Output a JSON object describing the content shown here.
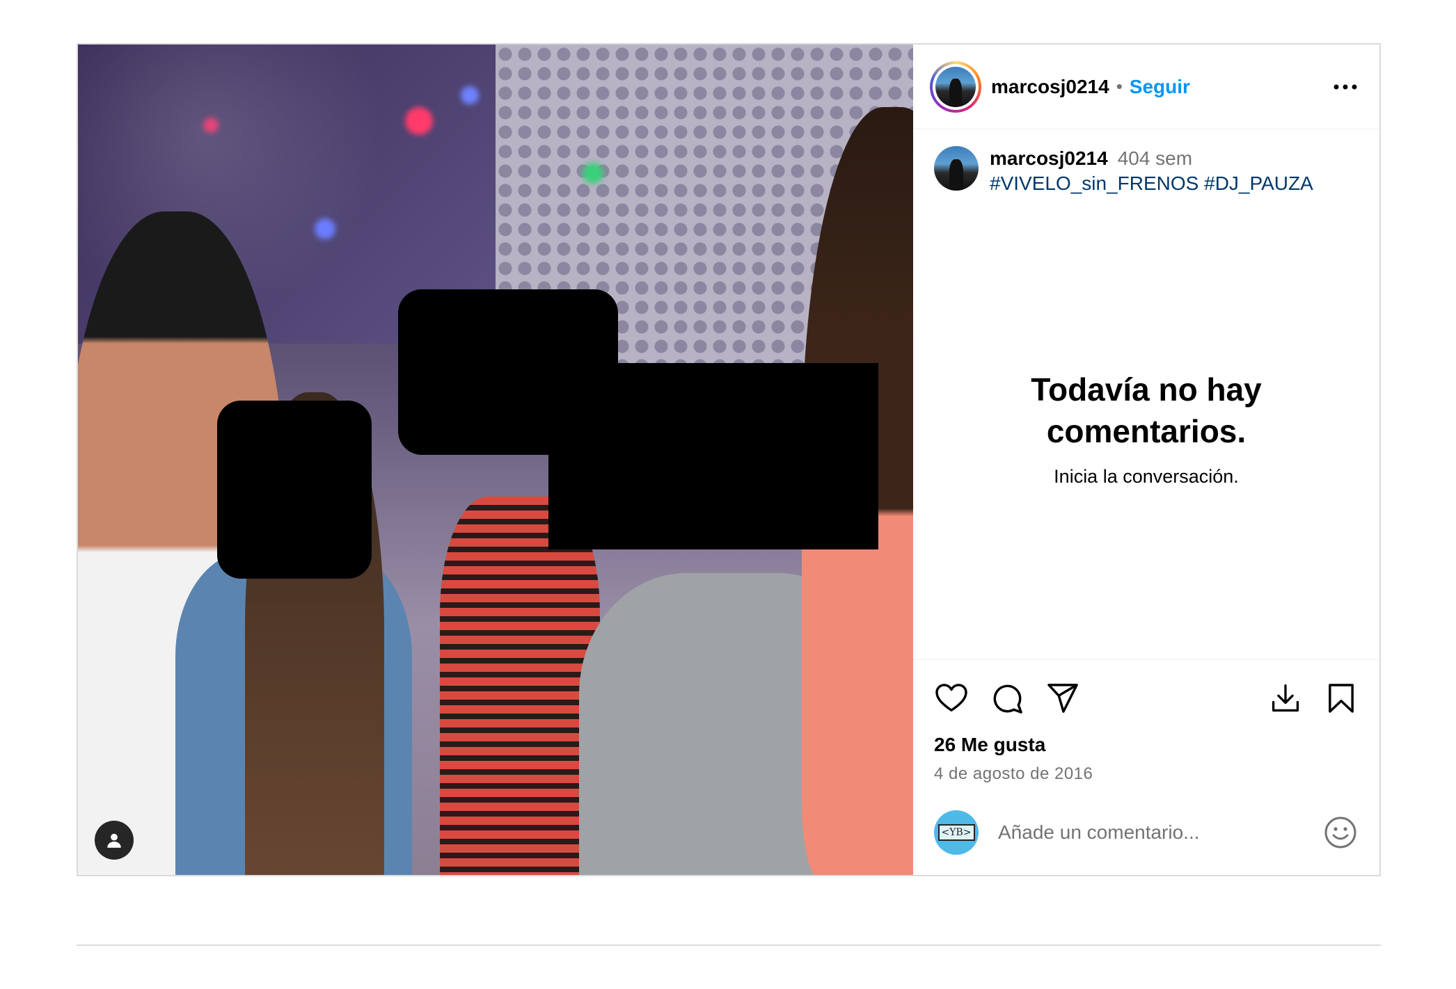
{
  "post": {
    "header": {
      "username": "marcosj0214",
      "separator": "•",
      "follow_label": "Seguir",
      "more_icon": "more-horizontal-icon"
    },
    "caption": {
      "username": "marcosj0214",
      "time": "404 sem",
      "text": "#VIVELO_sin_FRENOS #DJ_PAUZA"
    },
    "comments_empty": {
      "title": "Todavía no hay comentarios.",
      "subtitle": "Inicia la conversación."
    },
    "actions": {
      "like_icon": "heart-icon",
      "comment_icon": "comment-icon",
      "share_icon": "share-icon",
      "download_icon": "download-icon",
      "save_icon": "bookmark-icon"
    },
    "likes": "26 Me gusta",
    "date": "4 de agosto de 2016",
    "comment_box": {
      "avatar_text": "<YB>",
      "placeholder": "Añade un comentario...",
      "emoji_icon": "emoji-icon"
    },
    "media": {
      "tag_icon": "user-tag-icon"
    }
  }
}
